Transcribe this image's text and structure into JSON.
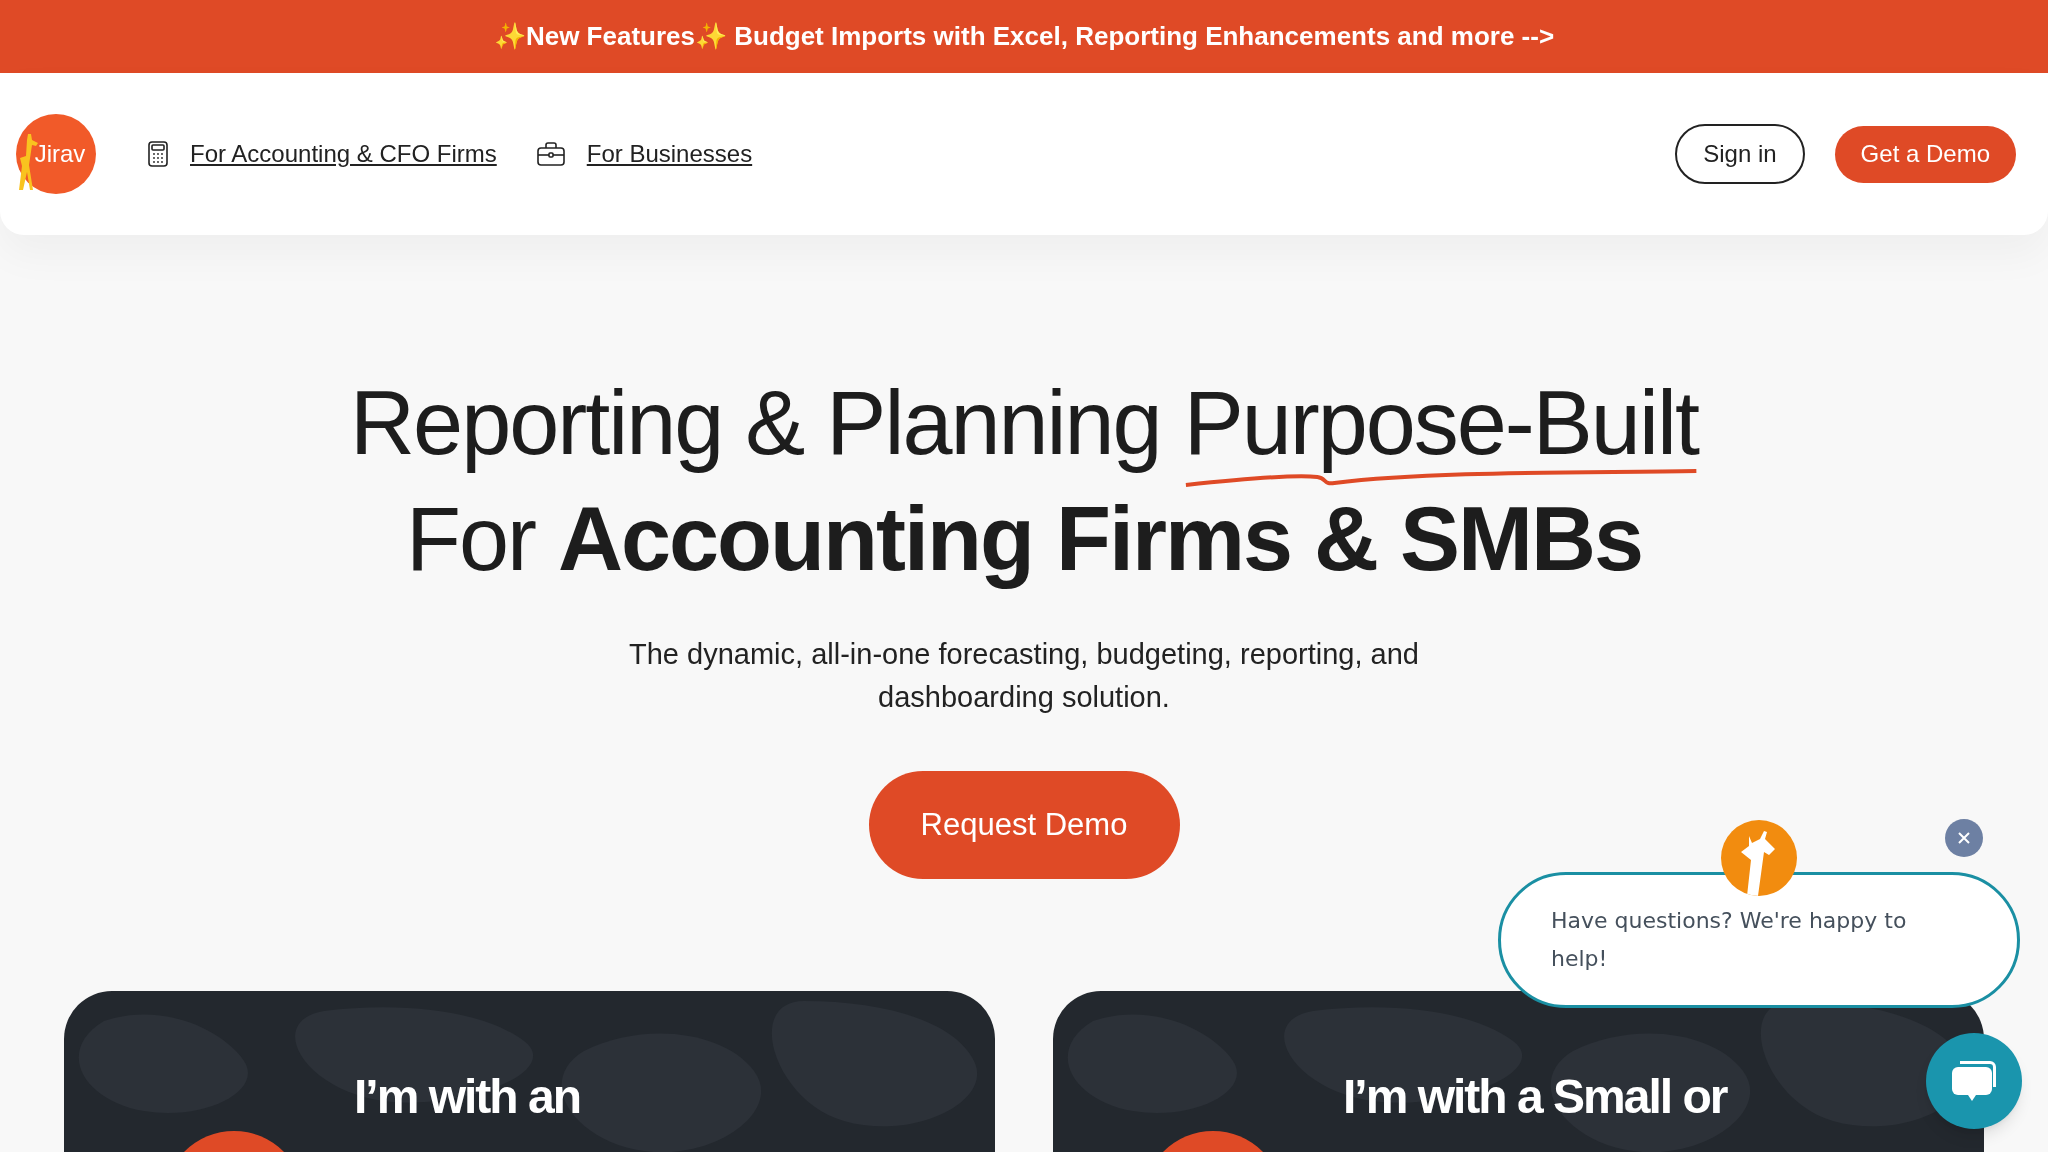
{
  "announcement": "✨New Features✨ Budget Imports with Excel, Reporting Enhancements and more -->",
  "nav": {
    "logo": "Jirav",
    "links": [
      {
        "label": "For Accounting & CFO Firms",
        "kind": "calculator"
      },
      {
        "label": "For Businesses",
        "kind": "briefcase"
      }
    ],
    "sign_in": "Sign in",
    "cta": "Get a Demo"
  },
  "hero": {
    "line_1": "Reporting & Planning",
    "line_1_underlined": "Purpose-Built",
    "line_2_lead": "For",
    "line_2_bold": "Accounting Firms & SMBs",
    "subtitle": "The dynamic, all-in-one forecasting, budgeting, reporting, and dashboarding solution.",
    "button": "Request Demo"
  },
  "cards": [
    {
      "title": "I’m with an"
    },
    {
      "title": "I’m with a Small or"
    }
  ],
  "chat": {
    "message": "Have questions? We're happy to help!"
  }
}
